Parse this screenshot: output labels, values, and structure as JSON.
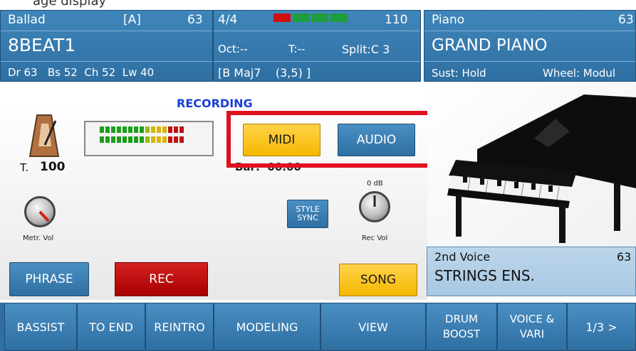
{
  "caption": "age display",
  "style_panel": {
    "style_category": "Ballad",
    "variation": "[A]",
    "volume": "63",
    "style_name": "8BEAT1",
    "mixer": "Dr 63   Bs 52  Ch 52  Lw 40"
  },
  "center_panel": {
    "time_signature": "4/4",
    "tempo": "110",
    "octave": "Oct:--",
    "transpose": "T:--",
    "split": "Split:C 3",
    "chord": "[B Maj7    (3,5) ]"
  },
  "voice_panel": {
    "category": "Piano",
    "volume": "63",
    "voice_name": "GRAND PIANO",
    "sustain": "Sust: Hold",
    "wheel": "Wheel: Modul"
  },
  "recording": {
    "status": "RECORDING",
    "tempo_label": "T.",
    "tempo_value": "100",
    "bar": "Bar:  00.00",
    "midi_button": "MIDI",
    "audio_button": "AUDIO",
    "db_label": "0 dB",
    "metronome_vol_label": "Metr. Vol",
    "style_sync_label": "STYLE SYNC",
    "rec_vol_label": "Rec Vol",
    "phrase_button": "PHRASE",
    "rec_button": "REC",
    "song_button": "SONG"
  },
  "second_voice": {
    "label": "2nd Voice",
    "volume": "63",
    "name": "STRINGS ENS."
  },
  "bottom_bar": [
    "BASSIST",
    "TO END",
    "REINTRO",
    "MODELING",
    "VIEW",
    "DRUM BOOST",
    "VOICE & VARI",
    "1/3 >"
  ],
  "colors": {
    "panel_blue": "#2f6fa2",
    "selected_yellow": "#f5b800",
    "rec_red": "#c00000",
    "highlight_red": "#e0101f",
    "recording_text": "#1a3fd6"
  }
}
